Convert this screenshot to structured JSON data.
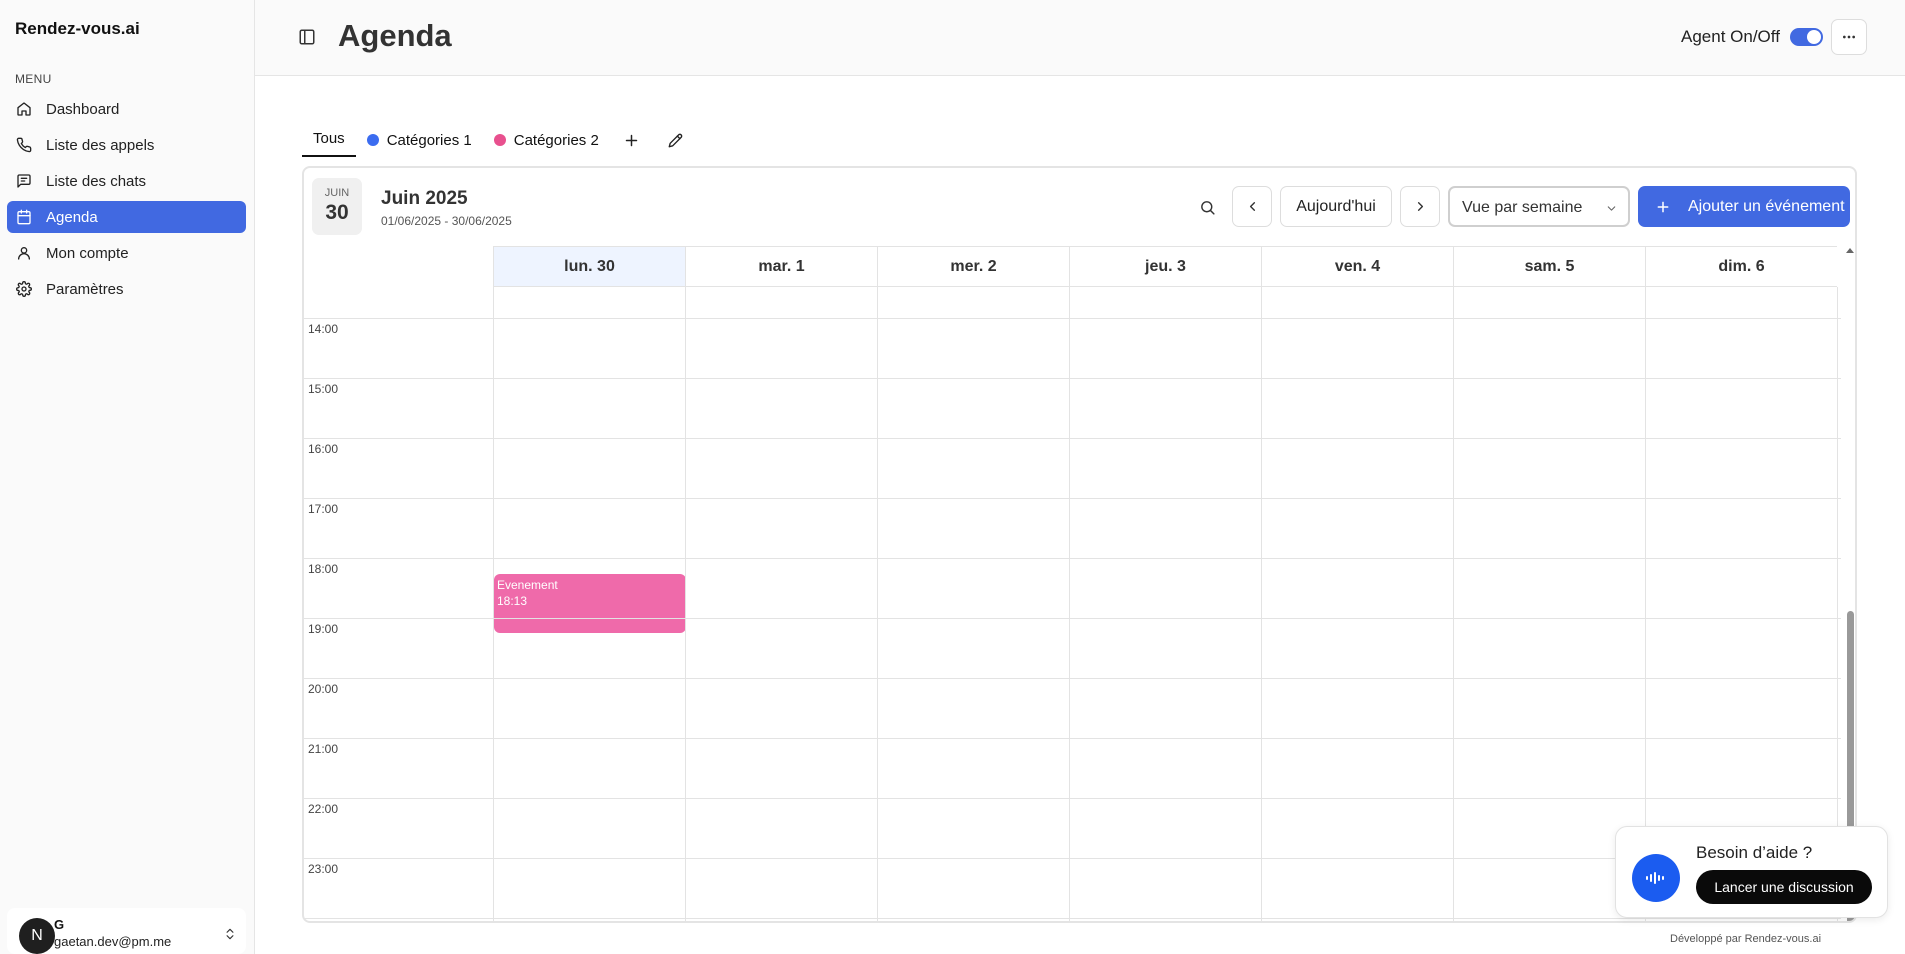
{
  "app": {
    "brand": "Rendez-vous.ai"
  },
  "sidebar": {
    "menu_label": "MENU",
    "items": [
      {
        "label": "Dashboard",
        "icon": "home-icon"
      },
      {
        "label": "Liste des appels",
        "icon": "phone-icon"
      },
      {
        "label": "Liste des chats",
        "icon": "chat-icon"
      },
      {
        "label": "Agenda",
        "icon": "calendar-icon",
        "active": true
      },
      {
        "label": "Mon compte",
        "icon": "user-icon"
      },
      {
        "label": "Paramètres",
        "icon": "gear-icon"
      }
    ],
    "user": {
      "initial": "N",
      "name": "G",
      "email": "gaetan.dev@pm.me"
    }
  },
  "header": {
    "title": "Agenda",
    "agent_label": "Agent On/Off",
    "agent_on": true
  },
  "tabs": [
    {
      "label": "Tous",
      "active": true
    },
    {
      "label": "Catégories 1",
      "color": "#3b6cf0"
    },
    {
      "label": "Catégories 2",
      "color": "#e8508e"
    }
  ],
  "calendar": {
    "badge_month": "JUIN",
    "badge_day": "30",
    "month_title": "Juin 2025",
    "range": "01/06/2025 - 30/06/2025",
    "today_label": "Aujourd'hui",
    "view_label": "Vue par semaine",
    "add_label": "Ajouter un événement",
    "days": [
      "lun. 30",
      "mar. 1",
      "mer. 2",
      "jeu. 3",
      "ven. 4",
      "sam. 5",
      "dim. 6"
    ],
    "hours": [
      "14:00",
      "15:00",
      "16:00",
      "17:00",
      "18:00",
      "19:00",
      "20:00",
      "21:00",
      "22:00",
      "23:00"
    ],
    "event": {
      "title": "Evenement",
      "time": "18:13",
      "color": "#ef6aaa"
    }
  },
  "help": {
    "title": "Besoin d’aide ?",
    "button": "Lancer une discussion"
  },
  "footer": {
    "note": "Développé par Rendez-vous.ai"
  }
}
